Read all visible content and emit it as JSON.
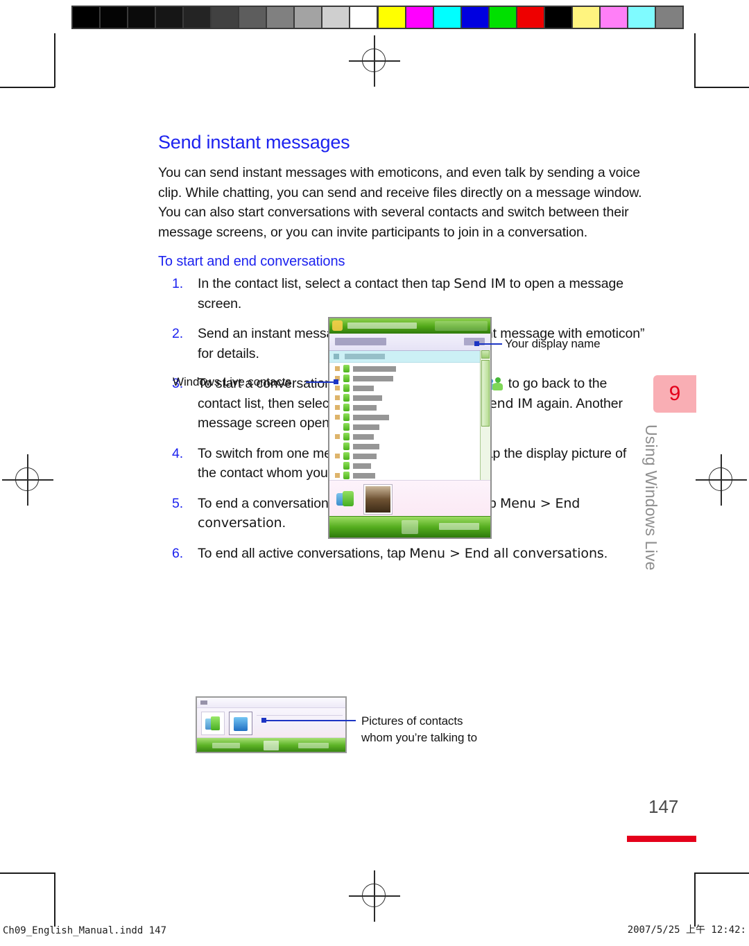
{
  "page": {
    "section_title": "Send instant messages",
    "intro": "You can send instant messages with emoticons, and even talk by sending a voice clip. While chatting, you can send and receive files directly on a message window. You can also start conversations with several contacts and switch between their message screens, or you can invite participants to join in a conversation.",
    "sub_title": "To start and end conversations",
    "page_number": "147",
    "chapter_number": "9",
    "chapter_running_head": "Using Windows Live",
    "accent_blue": "#1c22ef",
    "accent_red": "#e4001b",
    "tab_pink": "#f9aeb4"
  },
  "steps": [
    {
      "num": "1.",
      "parts": [
        {
          "type": "text",
          "value": "In the contact list, select a contact then tap "
        },
        {
          "type": "ui",
          "value": "Send IM"
        },
        {
          "type": "text",
          "value": " to open a message screen."
        }
      ]
    },
    {
      "num": "2.",
      "parts": [
        {
          "type": "text",
          "value": "Send an instant message. See “To send an instant message with emoticon” for details."
        }
      ]
    },
    {
      "num": "3.",
      "parts": [
        {
          "type": "text",
          "value": "To start a conversation with another contact, tap "
        },
        {
          "type": "icon",
          "value": "contacts-icon"
        },
        {
          "type": "text",
          "value": " to go back to the contact list, then select another contact and tap "
        },
        {
          "type": "ui",
          "value": "Send IM"
        },
        {
          "type": "text",
          "value": " again. Another message screen opens."
        }
      ]
    },
    {
      "num": "4.",
      "parts": [
        {
          "type": "text",
          "value": "To switch from one message screen to another, tap the display picture of the contact whom you want to talk to."
        }
      ]
    },
    {
      "num": "5.",
      "parts": [
        {
          "type": "text",
          "value": "To end a conversation with the current contact, tap "
        },
        {
          "type": "ui",
          "value": "Menu > End conversation"
        },
        {
          "type": "text",
          "value": "."
        }
      ]
    },
    {
      "num": "6.",
      "parts": [
        {
          "type": "text",
          "value": "To end all active conversations, tap "
        },
        {
          "type": "ui",
          "value": "Menu > End all conversations"
        },
        {
          "type": "text",
          "value": "."
        }
      ]
    }
  ],
  "callouts": {
    "display_name": "Your display name",
    "contacts": "Windows Live contacts",
    "pictures_line1": "Pictures of contacts",
    "pictures_line2": "whom you’re talking to"
  },
  "calibration": {
    "gray_swatches": [
      "#000000",
      "#040404",
      "#0b0b0b",
      "#161616",
      "#242424",
      "#414141",
      "#5d5d5d",
      "#808080",
      "#a3a3a3",
      "#cfcfcf",
      "#ffffff"
    ],
    "color_swatches": [
      "#ffff00",
      "#ff00ff",
      "#00ffff",
      "#0000e0",
      "#00e000",
      "#ee0000",
      "#000000",
      "#fff47f",
      "#ff7ff7",
      "#7ffbff",
      "#808080"
    ]
  },
  "footer": {
    "left": "Ch09_English_Manual.indd   147",
    "right": "2007/5/25   上午 12:42:"
  }
}
